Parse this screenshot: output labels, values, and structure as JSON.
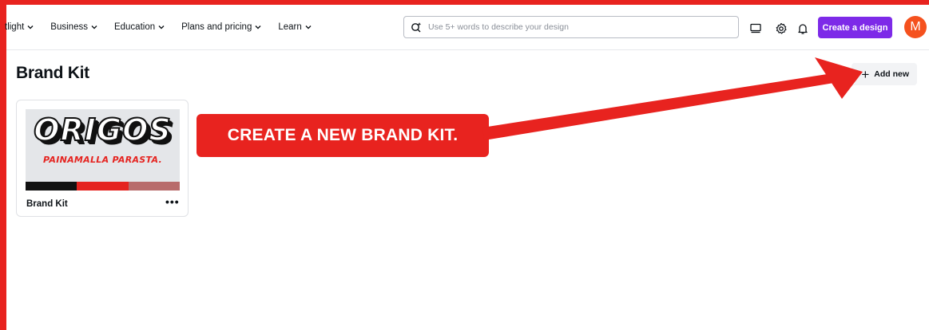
{
  "nav": {
    "items": [
      {
        "label": "tlight"
      },
      {
        "label": "Business"
      },
      {
        "label": "Education"
      },
      {
        "label": "Plans and pricing"
      },
      {
        "label": "Learn"
      }
    ]
  },
  "search": {
    "placeholder": "Use 5+ words to describe your design",
    "icon": "magic-search-icon"
  },
  "header_icons": [
    "monitor-icon",
    "gear-icon",
    "bell-icon"
  ],
  "create_button": {
    "label": "Create a design",
    "color": "#7d2ae8"
  },
  "avatar": {
    "initial": "M",
    "color": "#f5511e"
  },
  "page": {
    "title": "Brand Kit"
  },
  "add_new": {
    "plus": "+",
    "label": "Add new"
  },
  "brand_kit_card": {
    "logo_text": "ORIGOS",
    "tagline": "PAINAMALLA PARASTA.",
    "swatches": [
      "#111111",
      "#e5231f",
      "#b86b6b"
    ],
    "label": "Brand Kit",
    "menu": "•••"
  },
  "annotation": {
    "callout": "CREATE A NEW BRAND KIT.",
    "color": "#e8231f"
  }
}
